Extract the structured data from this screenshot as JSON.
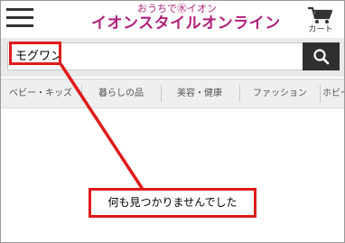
{
  "header": {
    "logo_sub": "おうちで㊌イオン",
    "logo_main": "イオンスタイルオンライン",
    "cart_label": "カート"
  },
  "search": {
    "query": "モグワン"
  },
  "categories": [
    {
      "label": "ベビー・キッズ"
    },
    {
      "label": "暮らしの品"
    },
    {
      "label": "美容・健康"
    },
    {
      "label": "ファッション"
    },
    {
      "label": "ホビー"
    }
  ],
  "annotation": {
    "message": "何も見つかりませんでした",
    "color": "#e01a1a"
  },
  "colors": {
    "brand": "#b0207a",
    "search_button": "#2f2f2f",
    "search_bar_bg": "#e9e9e9",
    "nav_bg": "#efefef"
  },
  "icons": {
    "menu": "hamburger-icon",
    "cart": "cart-icon",
    "search": "search-icon"
  }
}
